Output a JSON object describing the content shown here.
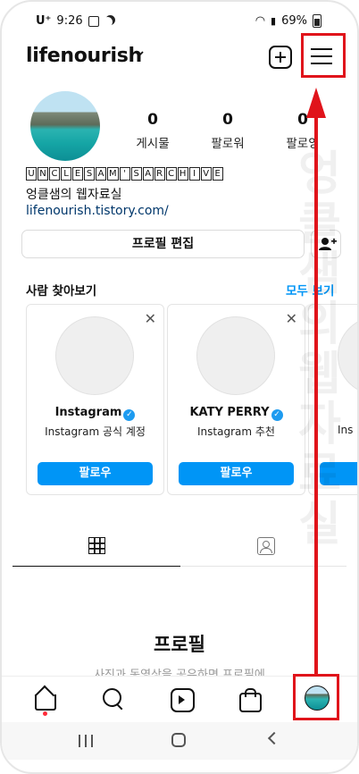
{
  "status_bar": {
    "carrier": "U⁺",
    "time": "9:26",
    "battery": "69%"
  },
  "header": {
    "username": "lifenourish"
  },
  "profile": {
    "stats": [
      {
        "value": "0",
        "label": "게시물"
      },
      {
        "value": "0",
        "label": "팔로워"
      },
      {
        "value": "0",
        "label": "팔로잉"
      }
    ],
    "bio_letters": [
      "U",
      "N",
      "C",
      "L",
      "E",
      "S",
      "A",
      "M",
      "'",
      "S",
      "A",
      "R",
      "C",
      "H",
      "I",
      "V",
      "E"
    ],
    "bio_name": "엉클샘의 웹자료실",
    "bio_link": "lifenourish.tistory.com/",
    "edit_button": "프로필 편집"
  },
  "discover": {
    "title": "사람 찾아보기",
    "see_all": "모두 보기",
    "cards": [
      {
        "name": "Instagram",
        "subtitle": "Instagram 공식 계정",
        "follow": "팔로우"
      },
      {
        "name": "KATY PERRY",
        "subtitle": "Instagram 추천",
        "follow": "팔로우"
      },
      {
        "name": "",
        "subtitle": "Ins",
        "follow": ""
      }
    ]
  },
  "empty_state": {
    "title": "프로필",
    "subtitle": "사진과 동영상을 공유하면 프로필에"
  },
  "watermark": "엉클샘의웹자료실",
  "colors": {
    "accent_blue": "#0095f6",
    "annotation_red": "#e0141b"
  }
}
